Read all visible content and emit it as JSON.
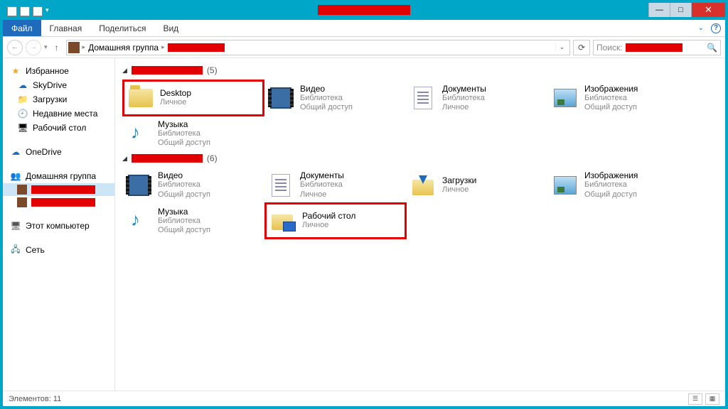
{
  "titlebar": {
    "redacted": true
  },
  "ribbon": {
    "file": "Файл",
    "tabs": [
      "Главная",
      "Поделиться",
      "Вид"
    ]
  },
  "address": {
    "root": "Домашняя группа",
    "redacted_segment": true
  },
  "search": {
    "label": "Поиск:"
  },
  "sidebar": {
    "favorites": {
      "title": "Избранное",
      "items": [
        "SkyDrive",
        "Загрузки",
        "Недавние места",
        "Рабочий стол"
      ]
    },
    "onedrive": "OneDrive",
    "homegroup": {
      "title": "Домашняя группа",
      "users": [
        "",
        ""
      ]
    },
    "computer": "Этот компьютер",
    "network": "Сеть"
  },
  "groups": [
    {
      "redacted": true,
      "count": "(5)",
      "items": [
        {
          "title": "Desktop",
          "sub1": "Личное",
          "icon": "folder",
          "hl": true
        },
        {
          "title": "Видео",
          "sub1": "Библиотека",
          "sub2": "Общий доступ",
          "icon": "video"
        },
        {
          "title": "Документы",
          "sub1": "Библиотека",
          "sub2": "Личное",
          "icon": "doc"
        },
        {
          "title": "Изображения",
          "sub1": "Библиотека",
          "sub2": "Общий доступ",
          "icon": "img"
        },
        {
          "title": "Музыка",
          "sub1": "Библиотека",
          "sub2": "Общий доступ",
          "icon": "music"
        }
      ]
    },
    {
      "redacted": true,
      "count": "(6)",
      "items": [
        {
          "title": "Видео",
          "sub1": "Библиотека",
          "sub2": "Общий доступ",
          "icon": "video"
        },
        {
          "title": "Документы",
          "sub1": "Библиотека",
          "sub2": "Личное",
          "icon": "doc"
        },
        {
          "title": "Загрузки",
          "sub1": "Личное",
          "icon": "download"
        },
        {
          "title": "Изображения",
          "sub1": "Библиотека",
          "sub2": "Общий доступ",
          "icon": "img"
        },
        {
          "title": "Музыка",
          "sub1": "Библиотека",
          "sub2": "Общий доступ",
          "icon": "music"
        },
        {
          "title": "Рабочий стол",
          "sub1": "Личное",
          "icon": "desktop",
          "hl": true
        }
      ]
    }
  ],
  "status": {
    "text": "Элементов: 11"
  }
}
